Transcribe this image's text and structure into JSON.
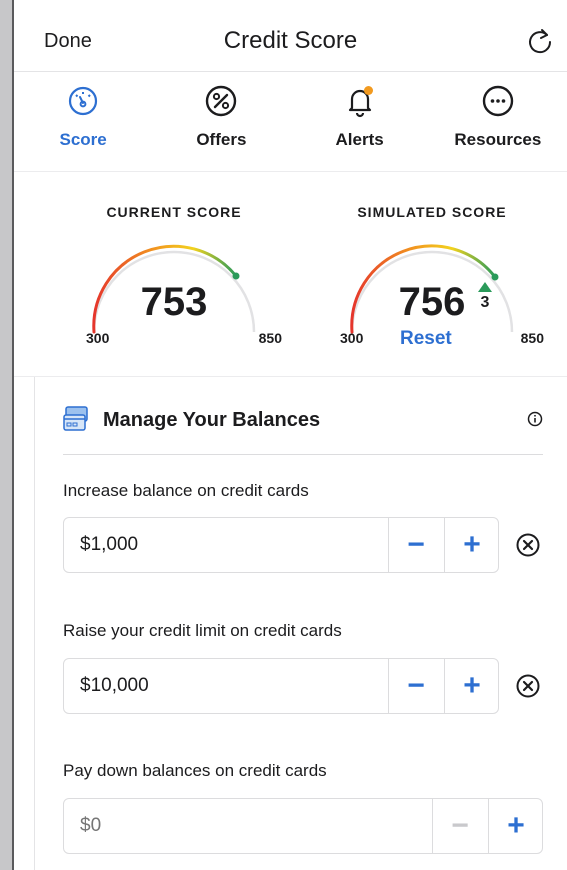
{
  "header": {
    "done_label": "Done",
    "title": "Credit Score",
    "refresh_icon": "refresh-icon"
  },
  "tabs": [
    {
      "label": "Score",
      "icon": "speedometer-icon",
      "active": true
    },
    {
      "label": "Offers",
      "icon": "percent-icon",
      "active": false
    },
    {
      "label": "Alerts",
      "icon": "bell-icon",
      "active": false
    },
    {
      "label": "Resources",
      "icon": "more-icon",
      "active": false
    }
  ],
  "current_score": {
    "heading": "CURRENT SCORE",
    "value": "753",
    "min": "300",
    "max": "850"
  },
  "simulated_score": {
    "heading": "SIMULATED SCORE",
    "value": "756",
    "delta": "3",
    "min": "300",
    "max": "850",
    "reset_label": "Reset"
  },
  "manage": {
    "title": "Manage Your Balances",
    "fields": [
      {
        "label": "Increase balance on credit cards",
        "value": "$1,000"
      },
      {
        "label": "Raise your credit limit on credit cards",
        "value": "$10,000"
      },
      {
        "label": "Pay down balances on credit cards",
        "placeholder": "$0"
      }
    ],
    "minus_glyph": "−",
    "plus_glyph": "+"
  },
  "colors": {
    "accent": "#2d6fd1",
    "gauge_red": "#e5352c",
    "gauge_orange": "#f29a1f",
    "gauge_yellow": "#f2d21f",
    "gauge_green": "#2a9a5a",
    "track": "#e2e2e4"
  }
}
